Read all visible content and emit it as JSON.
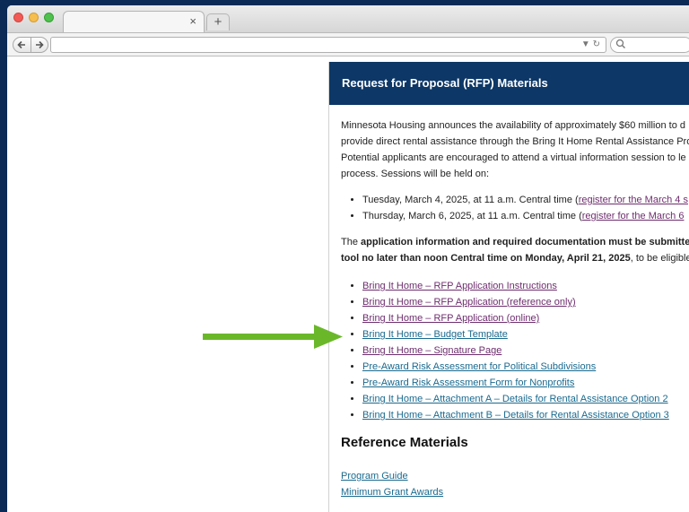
{
  "browser": {
    "tab_title": "",
    "tab_close": "×",
    "new_tab": "+",
    "url": "",
    "search_placeholder": ""
  },
  "panel": {
    "title": "Request for Proposal (RFP) Materials",
    "intro_lines": [
      "Minnesota Housing announces the availability of approximately $60 million to d",
      "provide direct rental assistance through the Bring It Home Rental Assistance Pro",
      "Potential applicants are encouraged to attend a virtual information session to le",
      "process. Sessions will be held on:"
    ],
    "sessions": [
      {
        "text": "Tuesday, March 4, 2025, at 11 a.m. Central time (",
        "link": "register for the March 4 s"
      },
      {
        "text": "Thursday, March 6, 2025, at 11 a.m. Central time (",
        "link": "register for the March 6"
      }
    ],
    "submit_line1_pre": "The ",
    "submit_line1_bold": "application information and required documentation must be submitted",
    "submit_line2_bold": "tool no later than noon Central time on Monday, April 21, 2025",
    "submit_line2_post": ", to be eligible",
    "documents": [
      "Bring It Home – RFP Application Instructions",
      "Bring It Home – RFP Application (reference only)",
      "Bring It Home – RFP Application (online)",
      "Bring It Home – Budget Template",
      "Bring It Home – Signature Page",
      "Pre-Award Risk Assessment for Political Subdivisions",
      "Pre-Award Risk Assessment Form for Nonprofits",
      "Bring It Home – Attachment A – Details for Rental Assistance Option 2",
      "Bring It Home – Attachment B – Details for Rental Assistance Option 3"
    ],
    "reference_heading": "Reference Materials",
    "reference_links": [
      "Program Guide",
      "Minimum Grant Awards"
    ]
  },
  "colors": {
    "header_bg": "#0d3766",
    "visited_link": "#6e2e6e",
    "link": "#1a6a8f",
    "arrow": "#6ab82a"
  }
}
